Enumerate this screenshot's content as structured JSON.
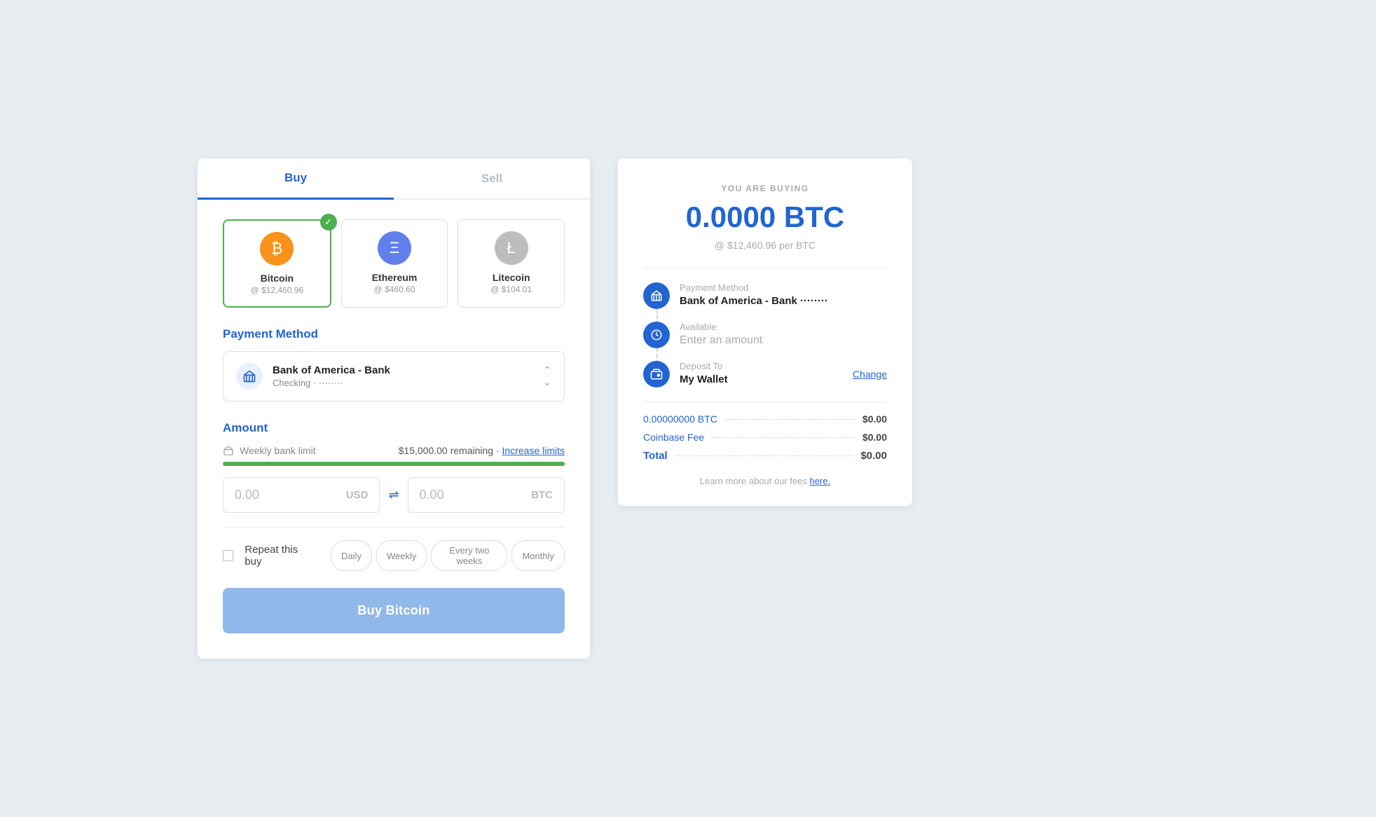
{
  "tabs": [
    {
      "id": "buy",
      "label": "Buy",
      "active": true
    },
    {
      "id": "sell",
      "label": "Sell",
      "active": false
    }
  ],
  "cryptos": [
    {
      "id": "btc",
      "name": "Bitcoin",
      "price": "@ $12,460.96",
      "selected": true,
      "symbol": "₿",
      "colorClass": "btc"
    },
    {
      "id": "eth",
      "name": "Ethereum",
      "price": "@ $460.60",
      "selected": false,
      "symbol": "Ξ",
      "colorClass": "eth"
    },
    {
      "id": "ltc",
      "name": "Litecoin",
      "price": "@ $104.01",
      "selected": false,
      "symbol": "Ł",
      "colorClass": "ltc"
    }
  ],
  "payment_method_section": "Payment Method",
  "payment": {
    "bank_name": "Bank of America - Bank",
    "account_type": "Checking · ········"
  },
  "amount_section": "Amount",
  "limit": {
    "label": "Weekly bank limit",
    "remaining": "$15,000.00 remaining",
    "separator": "·",
    "increase_label": "Increase limits"
  },
  "amount": {
    "usd_value": "0.00",
    "usd_currency": "USD",
    "btc_value": "0.00",
    "btc_currency": "BTC"
  },
  "repeat": {
    "label": "Repeat this buy",
    "frequencies": [
      "Daily",
      "Weekly",
      "Every two weeks",
      "Monthly"
    ]
  },
  "buy_button": "Buy Bitcoin",
  "receipt": {
    "you_are_buying": "YOU ARE BUYING",
    "btc_amount": "0.0000 BTC",
    "btc_rate": "@ $12,460.96 per BTC",
    "payment_method": {
      "title": "Payment Method",
      "value": "Bank of America - Bank ········"
    },
    "available": {
      "title": "Available",
      "placeholder": "Enter an amount"
    },
    "deposit_to": {
      "title": "Deposit To",
      "value": "My Wallet",
      "change_label": "Change"
    },
    "totals": [
      {
        "label": "0.00000000 BTC",
        "amount": "$0.00"
      },
      {
        "label": "Coinbase Fee",
        "amount": "$0.00"
      },
      {
        "label": "Total",
        "amount": "$0.00",
        "main": true
      }
    ],
    "fees_note": "Learn more about our fees",
    "fees_link": "here."
  }
}
